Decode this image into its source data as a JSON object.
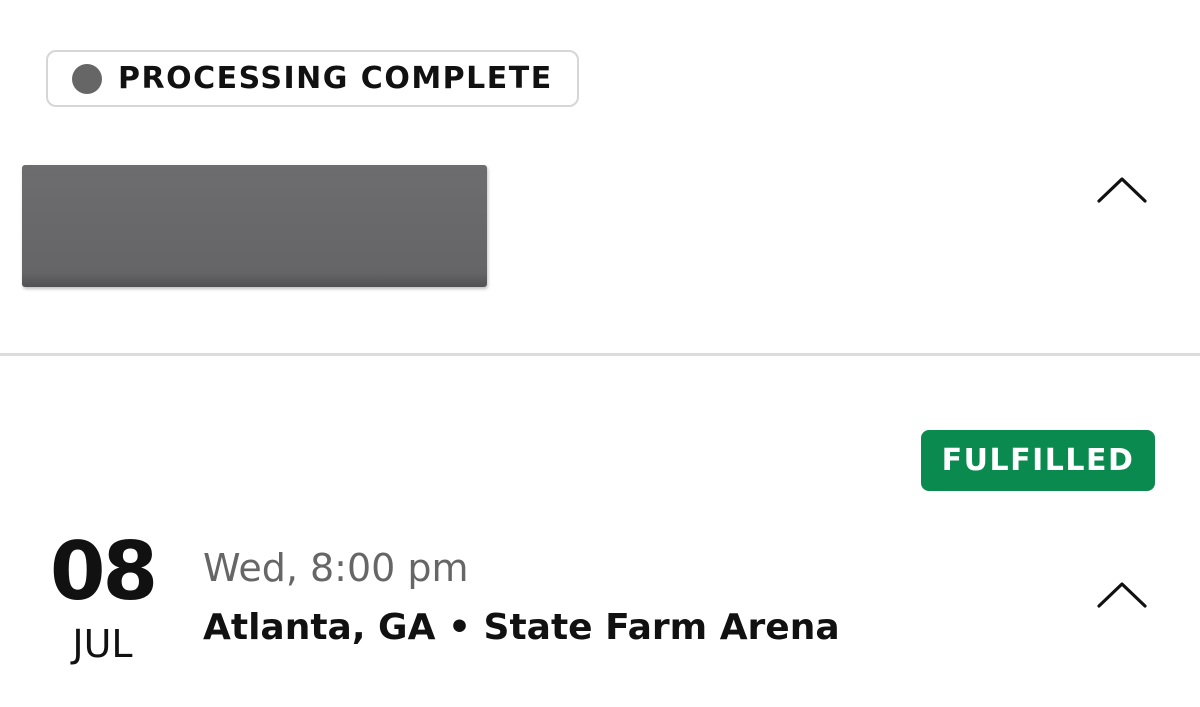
{
  "order": {
    "status_label": "PROCESSING COMPLETE",
    "status_dot_color": "#666666",
    "expand_icon": "chevron-up-icon"
  },
  "event": {
    "badge_label": "FULFILLED",
    "badge_color": "#0a8a4f",
    "day": "08",
    "month": "JUL",
    "time": "Wed, 8:00 pm",
    "venue": "Atlanta, GA • State Farm Arena",
    "expand_icon": "chevron-up-icon"
  }
}
